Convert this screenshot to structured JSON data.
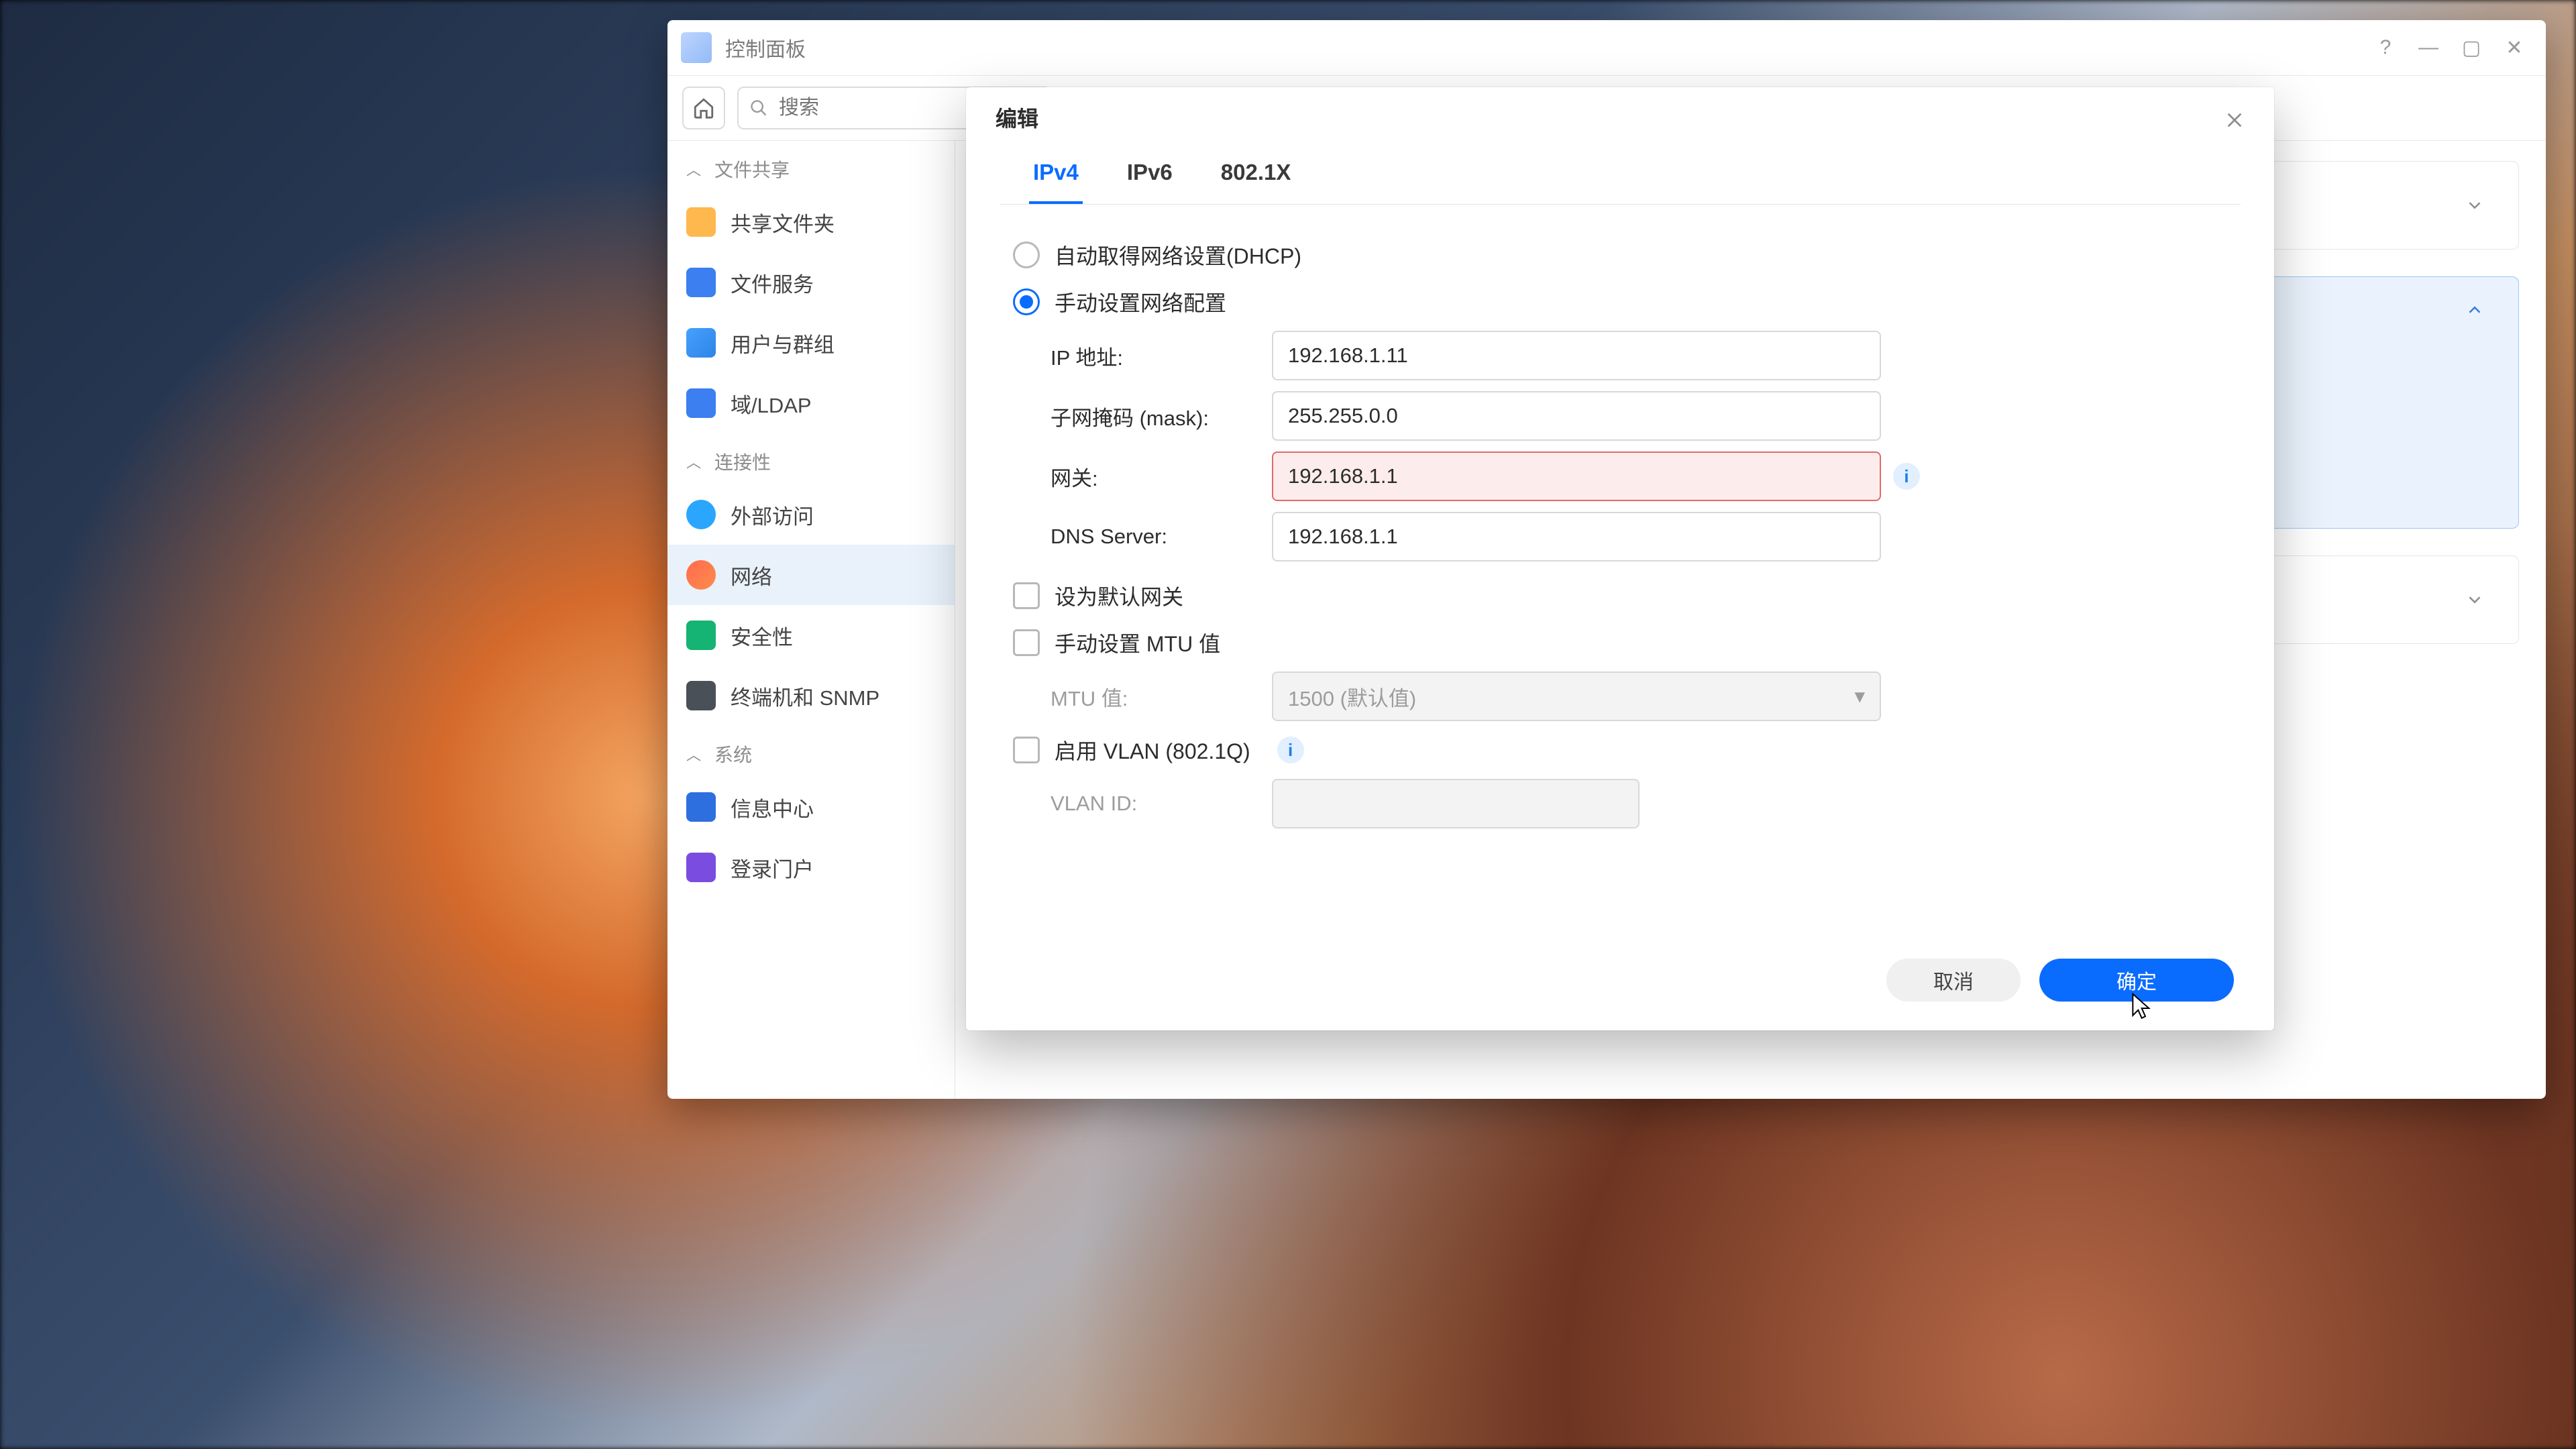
{
  "window": {
    "title": "控制面板",
    "controls": {
      "help": "?",
      "min": "—",
      "max": "▢",
      "close": "✕"
    }
  },
  "toolbar": {
    "search_placeholder": "搜索"
  },
  "sidebar": {
    "group1": {
      "label": "文件共享"
    },
    "items1": [
      {
        "label": "共享文件夹"
      },
      {
        "label": "文件服务"
      },
      {
        "label": "用户与群组"
      },
      {
        "label": "域/LDAP"
      }
    ],
    "group2": {
      "label": "连接性"
    },
    "items2": [
      {
        "label": "外部访问"
      },
      {
        "label": "网络"
      },
      {
        "label": "安全性"
      },
      {
        "label": "终端机和 SNMP"
      }
    ],
    "group3": {
      "label": "系统"
    },
    "items3": [
      {
        "label": "信息中心"
      },
      {
        "label": "登录门户"
      }
    ]
  },
  "modal": {
    "title": "编辑",
    "tabs": {
      "ipv4": "IPv4",
      "ipv6": "IPv6",
      "dot1x": "802.1X"
    },
    "radio_dhcp": "自动取得网络设置(DHCP)",
    "radio_manual": "手动设置网络配置",
    "labels": {
      "ip": "IP 地址:",
      "mask": "子网掩码 (mask):",
      "gateway": "网关:",
      "dns": "DNS Server:",
      "set_default_gw": "设为默认网关",
      "manual_mtu": "手动设置 MTU 值",
      "mtu": "MTU 值:",
      "enable_vlan": "启用 VLAN (802.1Q)",
      "vlan_id": "VLAN ID:",
      "mtu_default": "1500 (默认值)"
    },
    "values": {
      "ip": "192.168.1.11",
      "mask": "255.255.0.0",
      "gateway": "192.168.1.1",
      "dns": "192.168.1.1",
      "vlan_id": ""
    },
    "buttons": {
      "cancel": "取消",
      "ok": "确定"
    }
  }
}
